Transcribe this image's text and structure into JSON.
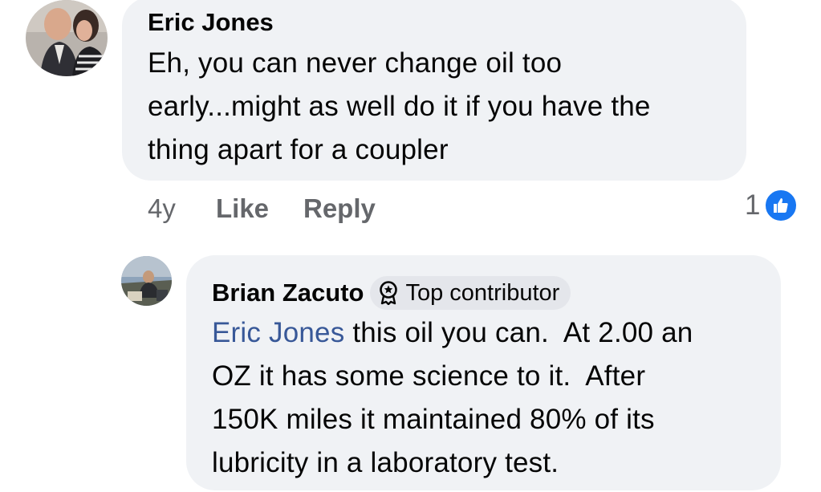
{
  "comment": {
    "author": "Eric Jones",
    "text_lines": [
      "Eh, you can never change oil too",
      "early...might as well do it if you have the",
      "thing apart for a coupler"
    ],
    "timestamp": "4y",
    "like_label": "Like",
    "reply_label": "Reply",
    "reaction_count": "1",
    "reaction_icon": "thumbs-up-icon",
    "colors": {
      "bubble": "#f0f2f5",
      "like": "#1877f2",
      "muted": "#65676b"
    }
  },
  "reply": {
    "author": "Brian Zacuto",
    "badge": {
      "label": "Top contributor",
      "icon": "award-ribbon-icon"
    },
    "mention": "Eric Jones",
    "text_lines": [
      " this oil you can.  At 2.00 an",
      "OZ it has some science to it.  After",
      "150K miles it maintained 80% of its",
      "lubricity in a laboratory test."
    ],
    "colors": {
      "mention": "#385898"
    }
  }
}
